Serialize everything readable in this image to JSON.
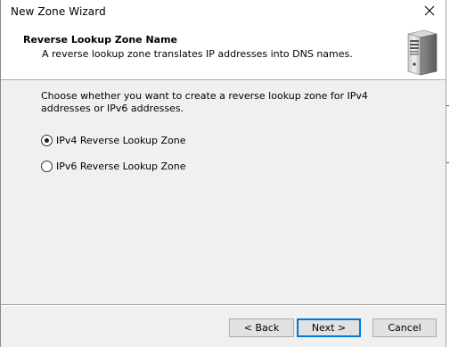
{
  "window": {
    "title": "New Zone Wizard"
  },
  "header": {
    "title": "Reverse Lookup Zone Name",
    "subtitle": "A reverse lookup zone translates IP addresses into DNS names.",
    "icon": "server-icon"
  },
  "body": {
    "instructions": "Choose whether you want to create a reverse lookup zone for IPv4 addresses or IPv6 addresses.",
    "options": [
      {
        "label": "IPv4 Reverse Lookup Zone",
        "selected": true
      },
      {
        "label": "IPv6 Reverse Lookup Zone",
        "selected": false
      }
    ]
  },
  "footer": {
    "back_label": "< Back",
    "next_label": "Next >",
    "cancel_label": "Cancel"
  },
  "colors": {
    "accent": "#0078d7",
    "dialog_bg": "#f0f0f0",
    "header_bg": "#ffffff"
  }
}
